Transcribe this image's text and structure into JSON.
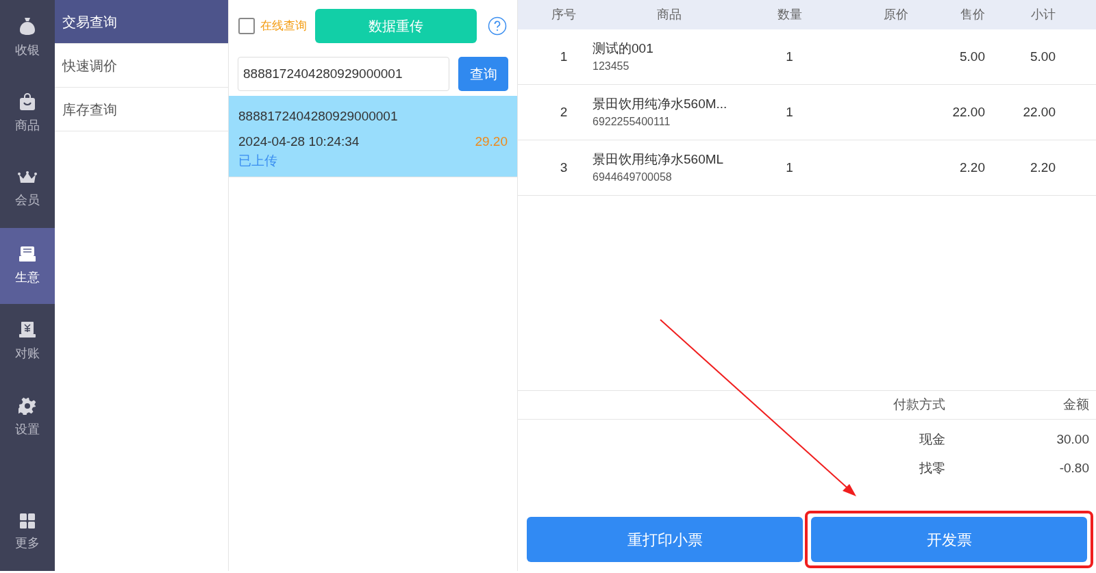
{
  "nav": [
    {
      "label": "收银",
      "kind": "moneybag",
      "selected": false
    },
    {
      "label": "商品",
      "kind": "bag",
      "selected": false
    },
    {
      "label": "会员",
      "kind": "crown",
      "selected": false
    },
    {
      "label": "生意",
      "kind": "printer",
      "selected": true
    },
    {
      "label": "对账",
      "kind": "ledger",
      "selected": false
    },
    {
      "label": "设置",
      "kind": "gear",
      "selected": false
    },
    {
      "label": "更多",
      "kind": "grid",
      "selected": false
    }
  ],
  "submenu": [
    {
      "label": "交易查询",
      "selected": true
    },
    {
      "label": "快速调价",
      "selected": false
    },
    {
      "label": "库存查询",
      "selected": false
    }
  ],
  "search_panel": {
    "online_label": "在线查询",
    "online_checked": false,
    "reupload_button": "数据重传",
    "query_value": "8888172404280929000001",
    "query_button": "查询"
  },
  "transactions": [
    {
      "number": "8888172404280929000001",
      "time": "2024-04-28 10:24:34",
      "amount": "29.20",
      "status": "已上传",
      "selected": true
    }
  ],
  "table": {
    "columns": [
      "序号",
      "商品",
      "数量",
      "原价",
      "售价",
      "小计"
    ],
    "rows": [
      {
        "index": "1",
        "name": "测试的001",
        "barcode": "123455",
        "qty": "1",
        "sale_price": "5.00",
        "subtotal": "5.00"
      },
      {
        "index": "2",
        "name": "景田饮用纯净水560M...",
        "barcode": "6922255400111",
        "qty": "1",
        "sale_price": "22.00",
        "subtotal": "22.00"
      },
      {
        "index": "3",
        "name": "景田饮用纯净水560ML",
        "barcode": "6944649700058",
        "qty": "1",
        "sale_price": "2.20",
        "subtotal": "2.20"
      }
    ]
  },
  "payment": {
    "columns": [
      "付款方式",
      "金额"
    ],
    "rows": [
      {
        "method": "现金",
        "amount": "30.00"
      },
      {
        "method": "找零",
        "amount": "-0.80"
      }
    ]
  },
  "buttons": [
    {
      "label": "重打印小票",
      "highlighted": false
    },
    {
      "label": "开发票",
      "highlighted": true
    }
  ]
}
